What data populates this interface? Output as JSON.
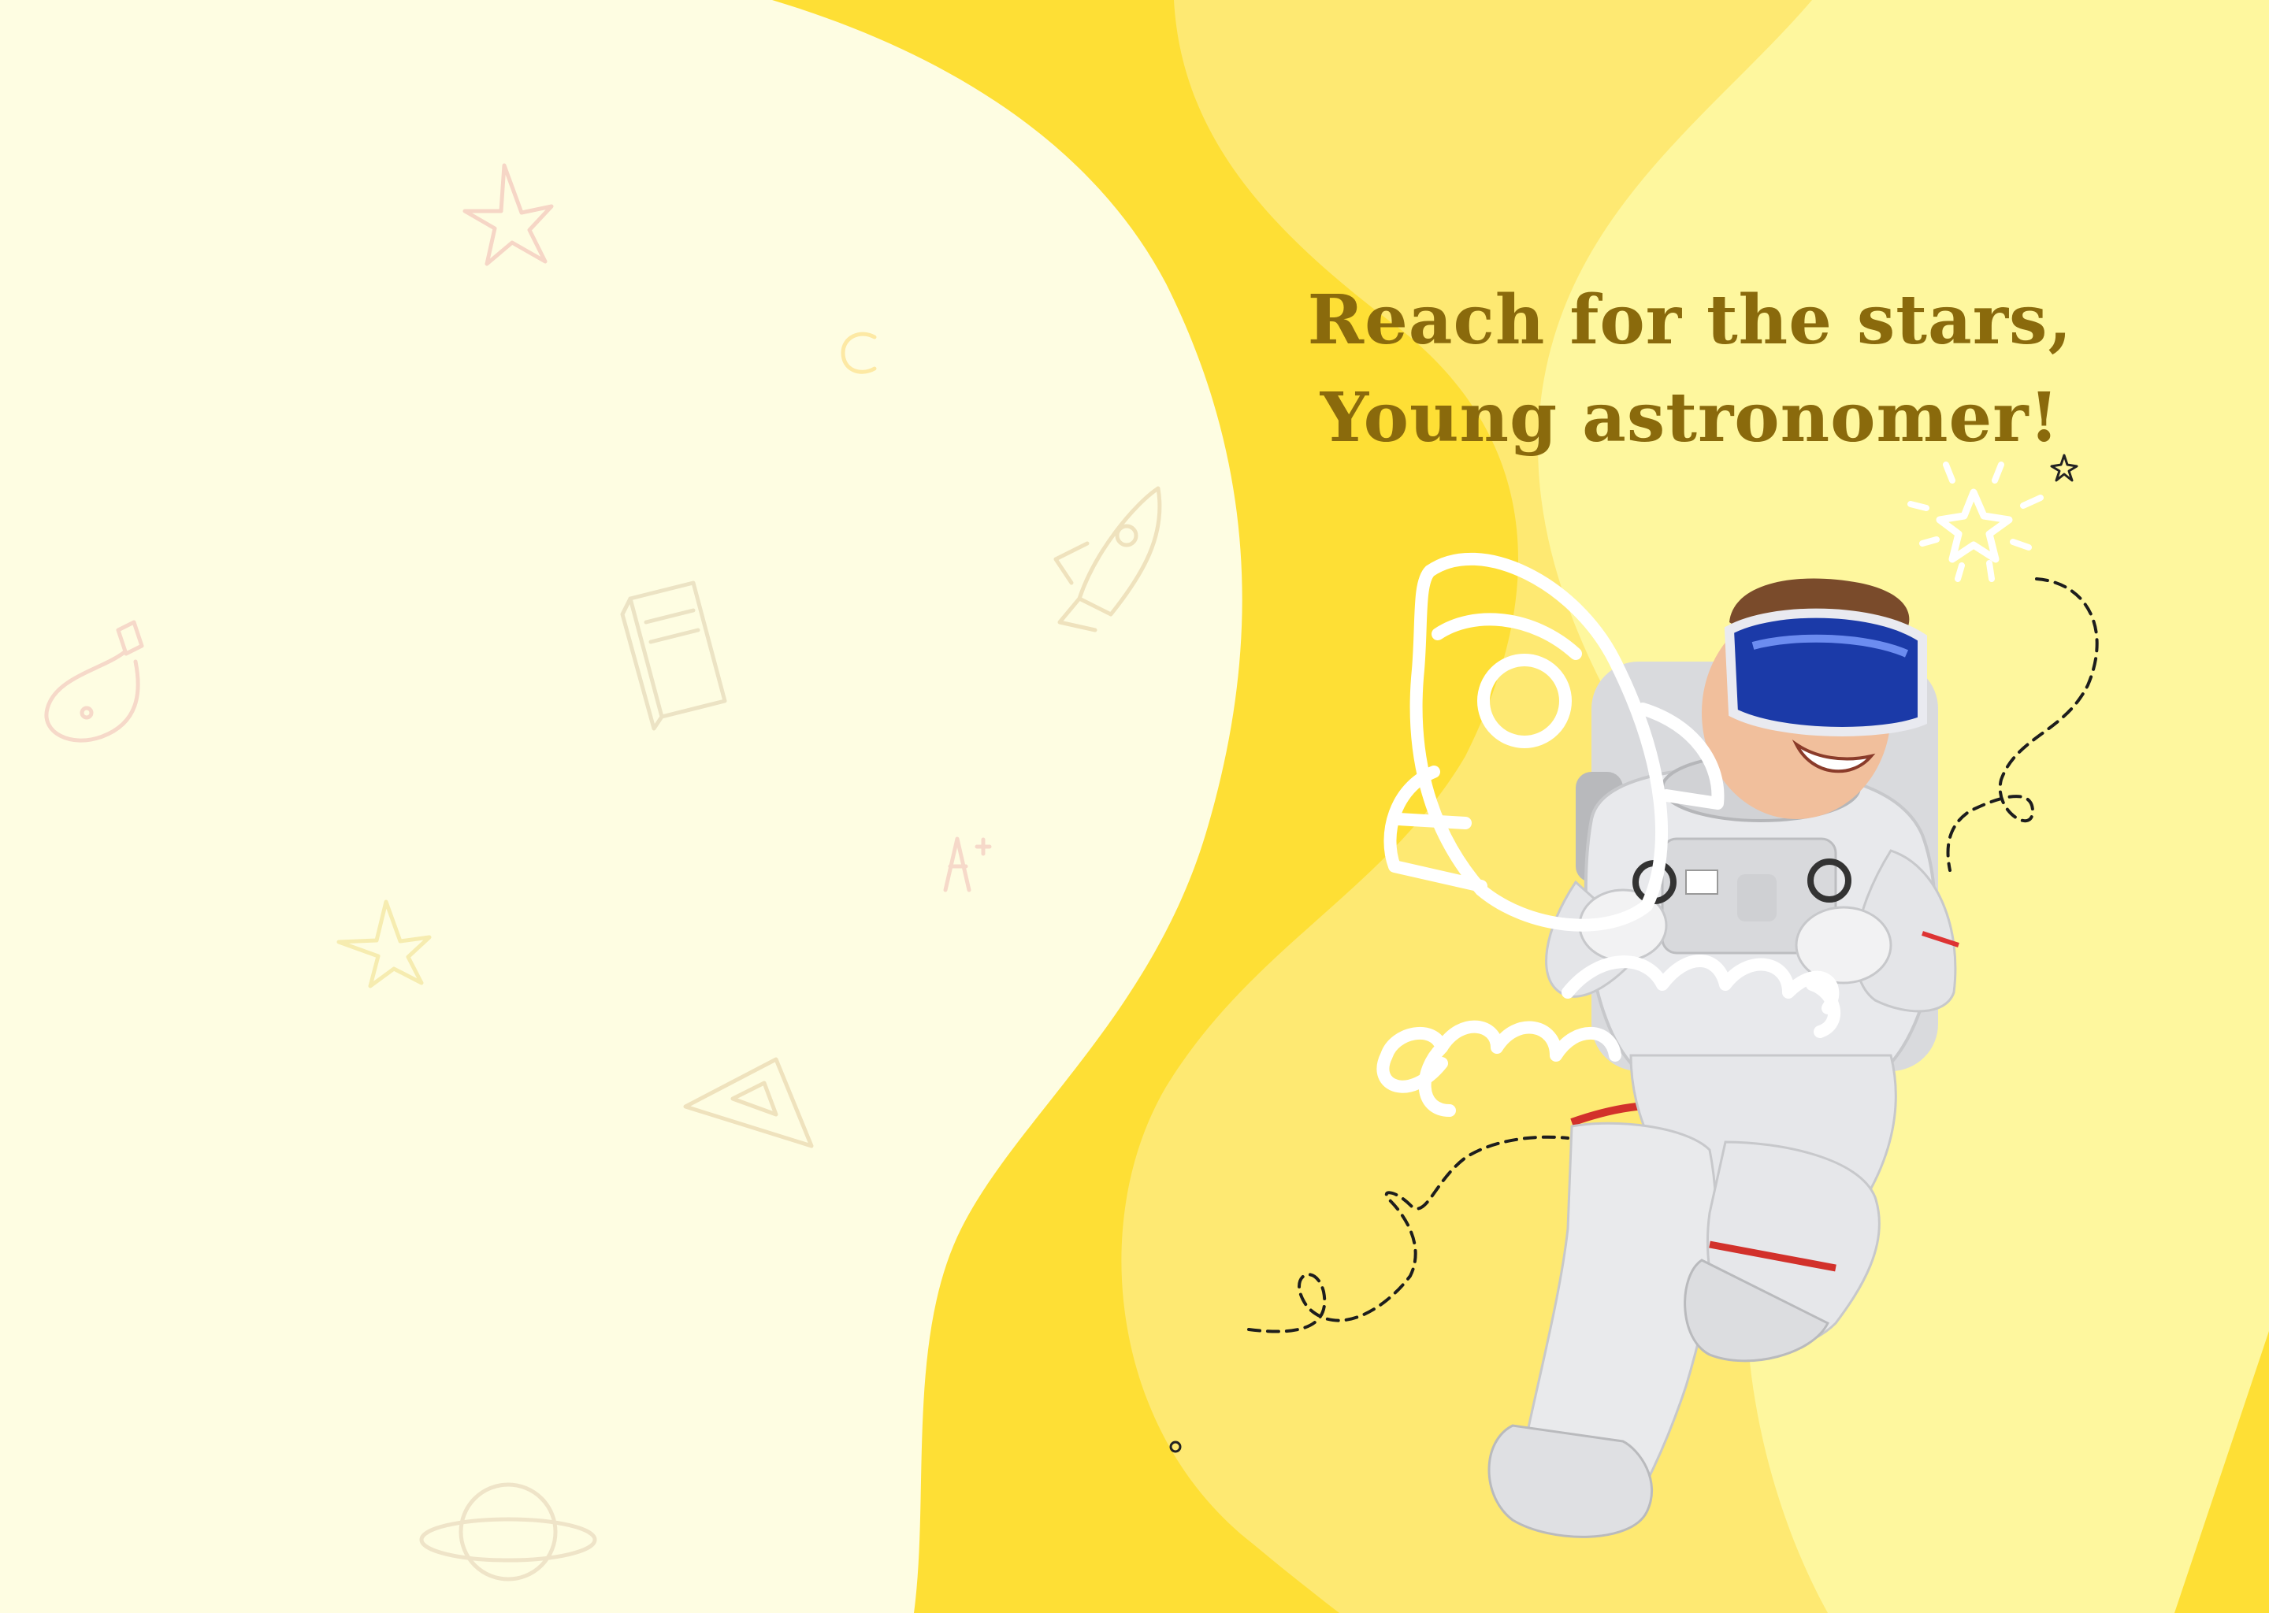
{
  "headline": {
    "line1": "Reach for the stars,",
    "line2": "Young astronomer!"
  },
  "colors": {
    "page_background": "#fefde2",
    "deep_yellow": "#fedf35",
    "mid_yellow": "#fee972",
    "light_yellow": "#fef79e",
    "headline_text": "#8a6a0c",
    "doodle_faint": "#f4d9b5"
  },
  "illustration": {
    "subject": "astronaut-child-with-vr-headset",
    "overlay_icon": "rocket-line-icon"
  },
  "background_doodles": [
    "star-doodle-icon",
    "letter-c-doodle",
    "rocket-doodle-icon",
    "book-doodle-icon",
    "flask-doodle-icon",
    "a-plus-doodle",
    "star-doodle-icon",
    "ruler-triangle-doodle-icon",
    "planet-doodle-icon"
  ]
}
